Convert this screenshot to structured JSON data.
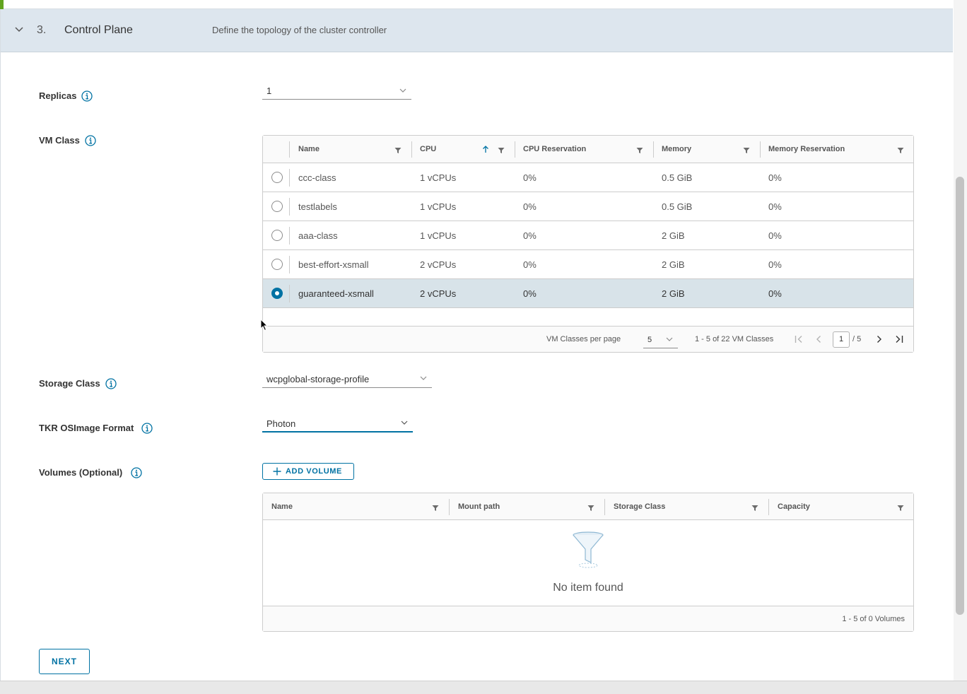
{
  "step": {
    "number": "3.",
    "title": "Control Plane",
    "description": "Define the topology of the cluster controller"
  },
  "replicas": {
    "label": "Replicas",
    "value": "1"
  },
  "vm_class": {
    "label": "VM Class",
    "columns": [
      "Name",
      "CPU",
      "CPU Reservation",
      "Memory",
      "Memory Reservation"
    ],
    "sort": {
      "column": "CPU",
      "direction": "ascending"
    },
    "rows": [
      {
        "name": "ccc-class",
        "cpu": "1 vCPUs",
        "cpu_reservation": "0%",
        "memory": "0.5 GiB",
        "memory_reservation": "0%",
        "selected": false
      },
      {
        "name": "testlabels",
        "cpu": "1 vCPUs",
        "cpu_reservation": "0%",
        "memory": "0.5 GiB",
        "memory_reservation": "0%",
        "selected": false
      },
      {
        "name": "aaa-class",
        "cpu": "1 vCPUs",
        "cpu_reservation": "0%",
        "memory": "2 GiB",
        "memory_reservation": "0%",
        "selected": false
      },
      {
        "name": "best-effort-xsmall",
        "cpu": "2 vCPUs",
        "cpu_reservation": "0%",
        "memory": "2 GiB",
        "memory_reservation": "0%",
        "selected": false
      },
      {
        "name": "guaranteed-xsmall",
        "cpu": "2 vCPUs",
        "cpu_reservation": "0%",
        "memory": "2 GiB",
        "memory_reservation": "0%",
        "selected": true
      }
    ],
    "footer": {
      "per_page_label": "VM Classes per page",
      "per_page_value": "5",
      "range_text": "1 - 5 of 22 VM Classes",
      "current_page": "1",
      "total_pages": "/ 5"
    }
  },
  "storage_class": {
    "label": "Storage Class",
    "value": "wcpglobal-storage-profile"
  },
  "tkr_format": {
    "label": "TKR OSImage Format",
    "value": "Photon"
  },
  "volumes": {
    "label": "Volumes (Optional)",
    "add_button": "ADD VOLUME",
    "columns": [
      "Name",
      "Mount path",
      "Storage Class",
      "Capacity"
    ],
    "empty_text": "No item found",
    "footer_text": "1 - 5 of 0 Volumes"
  },
  "next_button": "NEXT",
  "colors": {
    "accent": "#0072a3",
    "header_bg": "#dde6ee",
    "selected_row": "#d8e3e9",
    "status_green": "#62a420"
  }
}
